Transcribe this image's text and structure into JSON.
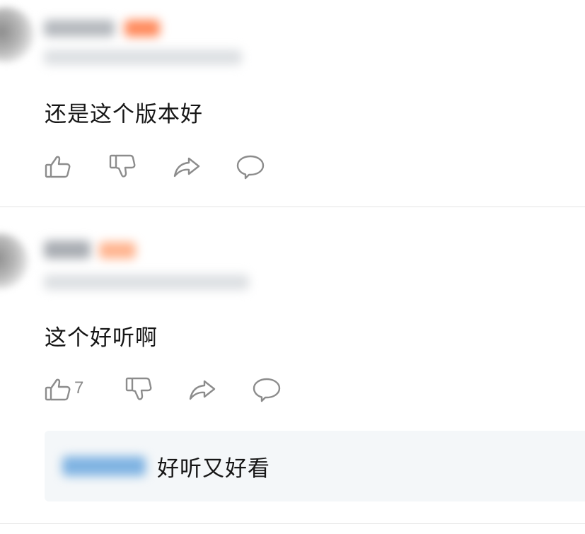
{
  "comments": [
    {
      "text": "还是这个版本好",
      "actions": {
        "like_icon": "thumbs-up-icon",
        "dislike_icon": "thumbs-down-icon",
        "share_icon": "share-arrow-icon",
        "reply_icon": "speech-bubble-icon"
      }
    },
    {
      "text": "这个好听啊",
      "like_count": "7",
      "actions": {
        "like_icon": "thumbs-up-icon",
        "dislike_icon": "thumbs-down-icon",
        "share_icon": "share-arrow-icon",
        "reply_icon": "speech-bubble-icon"
      },
      "reply": {
        "text": "好听又好看"
      }
    }
  ],
  "colors": {
    "icon_stroke": "#8c8c8c",
    "badge": "#ff8a5c",
    "reply_author": "#6aa4d8",
    "reply_bg": "#f4f7f9",
    "divider": "#e3e3e3"
  }
}
